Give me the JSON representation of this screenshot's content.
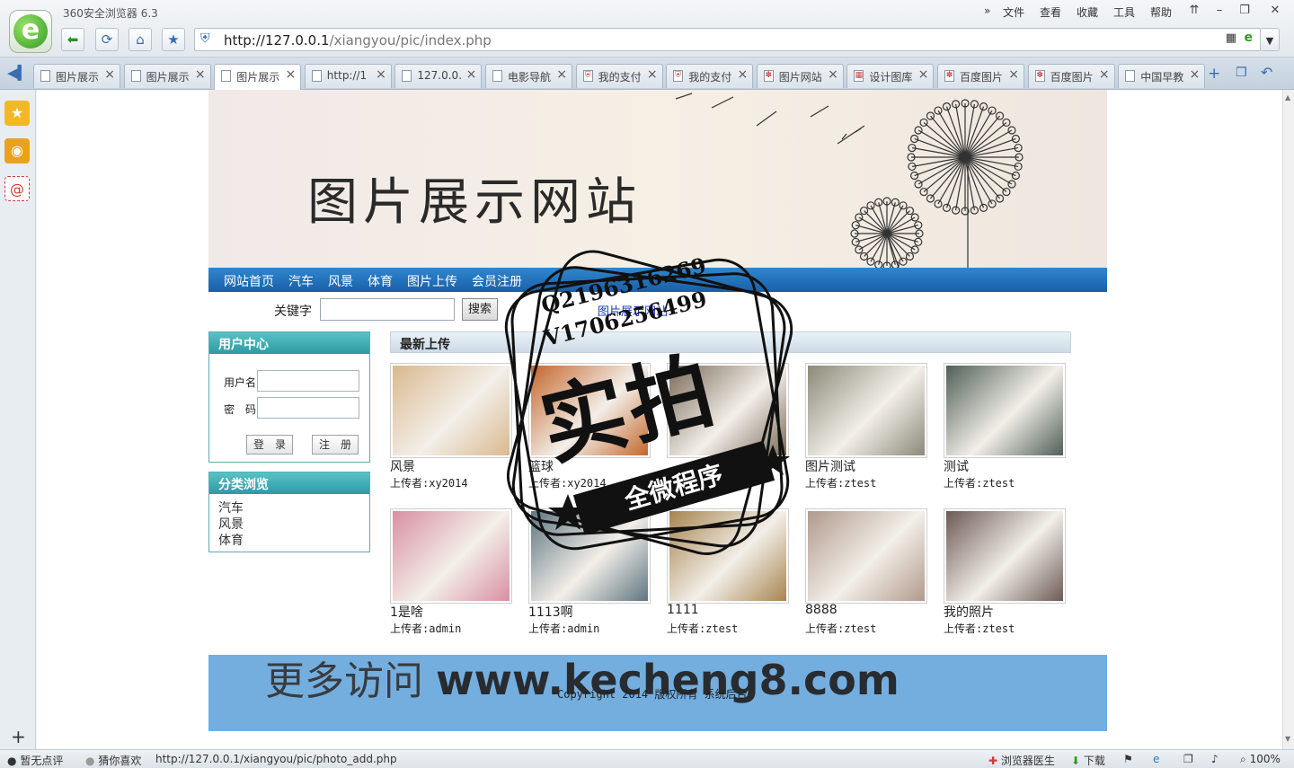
{
  "browser": {
    "app_title": "360安全浏览器 6.3",
    "menu": [
      "文件",
      "查看",
      "收藏",
      "工具",
      "帮助"
    ],
    "address_url_host": "http://127.0.0.1",
    "address_url_path": "/xiangyou/pic/index.php",
    "tabs": [
      {
        "label": "图片展示",
        "icon": "page-icon"
      },
      {
        "label": "图片展示",
        "icon": "page-icon"
      },
      {
        "label": "图片展示",
        "icon": "page-icon"
      },
      {
        "label": "http://1",
        "icon": "page-icon"
      },
      {
        "label": "127.0.0.",
        "icon": "page-icon"
      },
      {
        "label": "电影导航",
        "icon": "page-icon"
      },
      {
        "label": "我的支付",
        "icon": "shield-icon"
      },
      {
        "label": "我的支付",
        "icon": "shield-icon"
      },
      {
        "label": "图片网站",
        "icon": "paw-icon"
      },
      {
        "label": "设计图库",
        "icon": "grid-icon"
      },
      {
        "label": "百度图片",
        "icon": "paw-icon"
      },
      {
        "label": "百度图片",
        "icon": "paw-icon"
      },
      {
        "label": "中国早教",
        "icon": "page-icon"
      }
    ],
    "active_tab": 2
  },
  "site": {
    "title": "图片展示网站",
    "nav": [
      "网站首页",
      "汽车",
      "风景",
      "体育",
      "图片上传",
      "会员注册"
    ],
    "search_label": "关键字",
    "search_button": "搜索",
    "site_link": "图片展示网站",
    "user_center": {
      "title": "用户中心",
      "username_label": "用户名",
      "password_label": "密　码",
      "login": "登　录",
      "register": "注　册"
    },
    "categories": {
      "title": "分类浏览",
      "items": [
        "汽车",
        "风景",
        "体育"
      ]
    },
    "latest_title": "最新上传",
    "photos": [
      {
        "name": "风景",
        "uploader": "上传者:xy2014",
        "color": "#d9b98f"
      },
      {
        "name": "篮球",
        "uploader": "上传者:xy2014",
        "color": "#c4662c"
      },
      {
        "name": "",
        "uploader": "",
        "color": "#7a6a58"
      },
      {
        "name": "图片测试",
        "uploader": "上传者:ztest",
        "color": "#8b8a79"
      },
      {
        "name": "测试",
        "uploader": "上传者:ztest",
        "color": "#4f5f57"
      },
      {
        "name": "1是啥",
        "uploader": "上传者:admin",
        "color": "#d98fa3"
      },
      {
        "name": "1113啊",
        "uploader": "上传者:admin",
        "color": "#5f7581"
      },
      {
        "name": "1111",
        "uploader": "上传者:ztest",
        "color": "#a7844f"
      },
      {
        "name": "8888",
        "uploader": "上传者:ztest",
        "color": "#b09a8c"
      },
      {
        "name": "我的照片",
        "uploader": "上传者:ztest",
        "color": "#6c5a55"
      }
    ],
    "footer": {
      "copyright": "Copyright 2014 版权所有 系统后台"
    }
  },
  "watermark": {
    "more_prefix": "更多访问",
    "more_url": "www.kecheng8.com",
    "stamp_q": "Q2196316269",
    "stamp_v": "V1706256499",
    "stamp_big": "实拍",
    "stamp_ribbon": "全微程序"
  },
  "status": {
    "rating": "暂无点评",
    "guess": "猜你喜欢",
    "link_url": "http://127.0.0.1/xiangyou/pic/photo_add.php",
    "doctor": "浏览器医生",
    "download": "下载",
    "zoom": "100%"
  }
}
